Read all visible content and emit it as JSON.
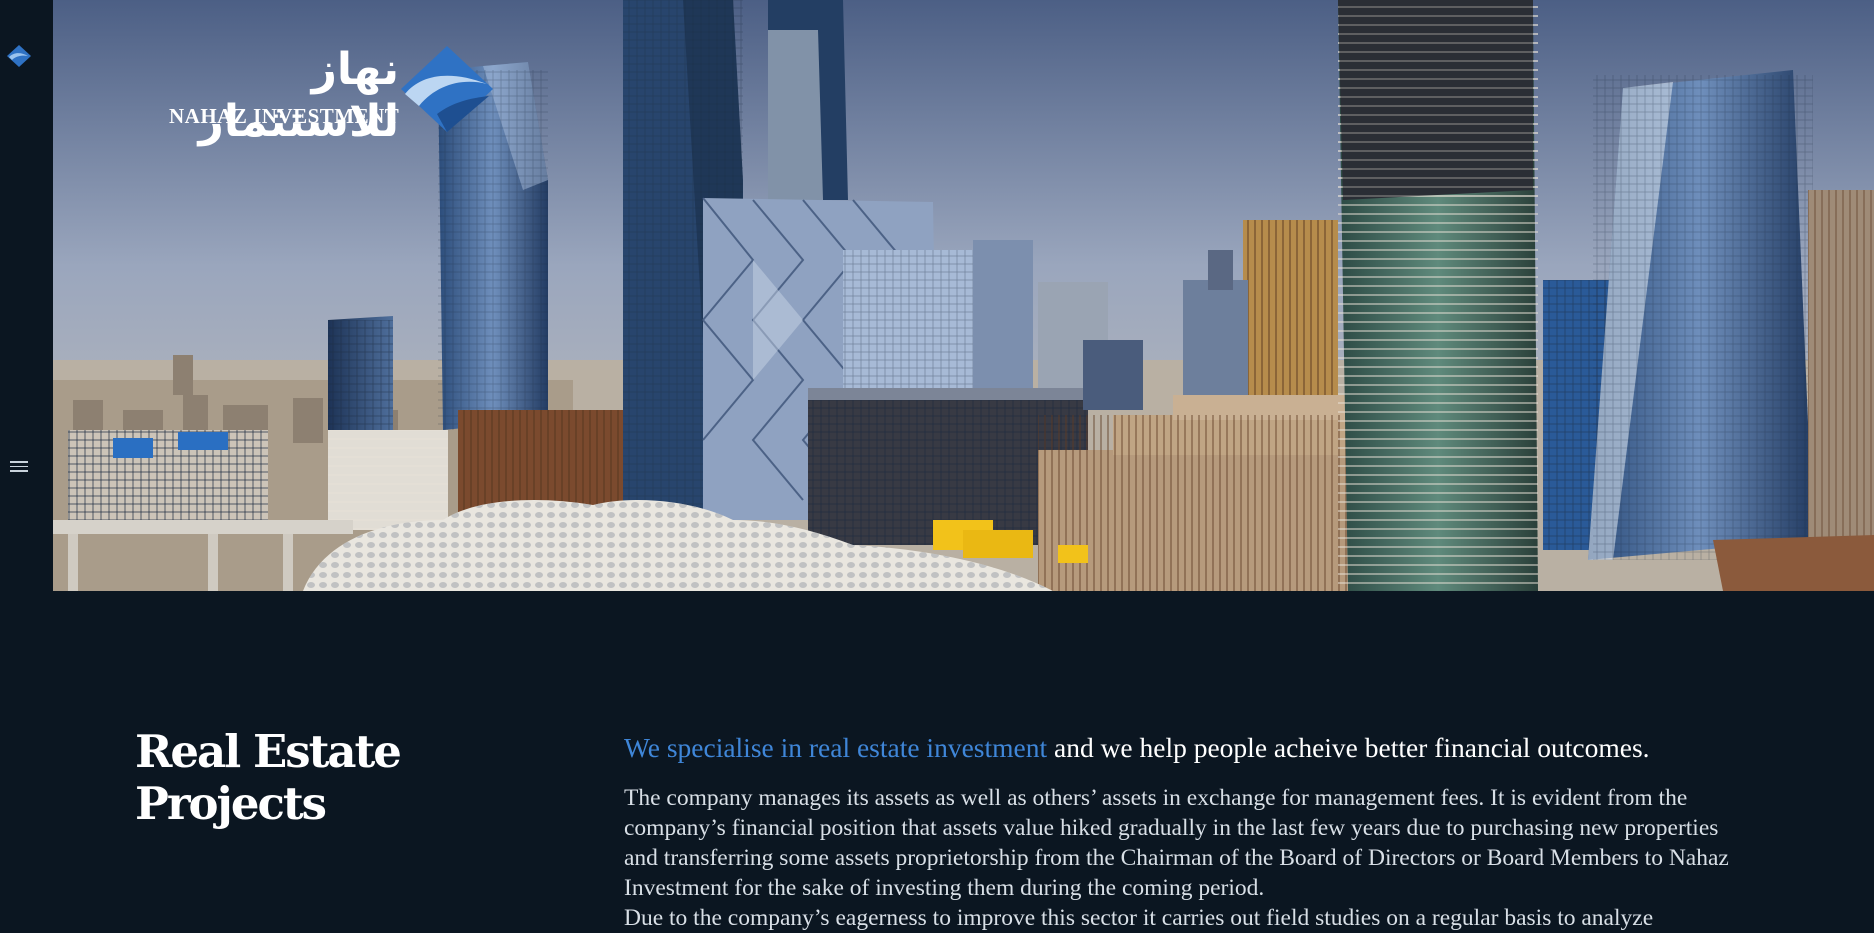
{
  "brand": {
    "name_ar": "نهاز للاستثمار",
    "name_en": "NAHAZ INVESTMENT",
    "mark_icon": "diamond-wave-logo-icon",
    "accent_color": "#2f72c4"
  },
  "nav": {
    "menu_icon": "hamburger-menu-icon"
  },
  "hero": {
    "image": "city-skyline-photo"
  },
  "section": {
    "title": "Real Estate Projects",
    "lead_highlight": "We specialise in real estate investment",
    "lead_rest": " and we help people acheive better financial outcomes.",
    "paragraph_1": "The company manages its assets as well as others’ assets in exchange for management fees. It is evident from the company’s financial position that assets value hiked gradually in the last few years due to purchasing new properties and transferring some assets proprietorship from the Chairman of the Board of Directors or Board Members to Nahaz Investment for the sake of investing them during the coming period.",
    "paragraph_2": "Due to the company’s eagerness to improve this sector it carries out field studies on a regular basis to analyze"
  },
  "colors": {
    "background": "#0b1621",
    "accent": "#3f86d8",
    "text": "#ffffff"
  }
}
